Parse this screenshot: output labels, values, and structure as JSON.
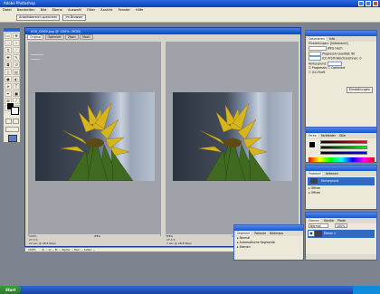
{
  "app": {
    "title": "Adobe Photoshop"
  },
  "menu": [
    "Datei",
    "Bearbeiten",
    "Bild",
    "Ebene",
    "Auswahl",
    "Filter",
    "Ansicht",
    "Fenster",
    "Hilfe"
  ],
  "toolbar": {
    "button1": "Arbeitsbereich speichern",
    "button2": "Im Browser"
  },
  "document": {
    "title": "000_0009.jpg @ 100% (RGB)",
    "tabs": [
      "Original",
      "Optimiert",
      "2fach",
      "4fach"
    ],
    "left_status": [
      "100%",
      "27,4 K",
      "22 sec @ 28,8 Kbps"
    ],
    "left_status_right": "JPEG",
    "right_status": [
      "JPEG",
      "27,4 K",
      "7 sec @ 28,8 Kbps"
    ],
    "right_status_right": "100% Qualität",
    "bottom_bar": [
      "100%",
      "R: --  G: --  B: --  Alpha: --  Hex: --  Index: --"
    ]
  },
  "optimize_panel": {
    "tabs": [
      "Optimieren",
      "Info"
    ],
    "rows": [
      "Einstellungen: [Unbenannt]",
      "JPEG  Hoch",
      "Progressiv  Qualität: 60",
      "ICC-Profil  Weichzeichnen: 0",
      "Hintergrund:"
    ],
    "checkbox1": "Progressiv",
    "checkbox2": "Optimiert",
    "checkbox3": "ICC-Profil",
    "footer_btn": "Einstellungen"
  },
  "color_panel": {
    "tabs": [
      "Farbe",
      "Farbfelder",
      "Stile"
    ],
    "labels": [
      "R",
      "G",
      "B"
    ]
  },
  "history_panel": {
    "tabs": [
      "Protokoll",
      "Aktionen"
    ],
    "items": [
      "Hintergrund",
      "Öffnen",
      "Öffnen"
    ]
  },
  "slice_panel": {
    "tabs": [
      "Segment",
      "Rollover",
      "Bildmaps"
    ],
    "items": [
      "Normal",
      "Automatische Segmente",
      "Ebenen"
    ]
  },
  "layers_panel": {
    "tabs": [
      "Ebenen",
      "Kanäle",
      "Pfade"
    ],
    "mode": "Normal",
    "opacity": "100%",
    "layer_name": "Ebene 1"
  },
  "taskbar": {
    "start": "Start"
  },
  "colors": {
    "titlebar": "#0a3fb8",
    "panel_bg": "#ece9d8",
    "layer_selected": "#316ac5"
  }
}
